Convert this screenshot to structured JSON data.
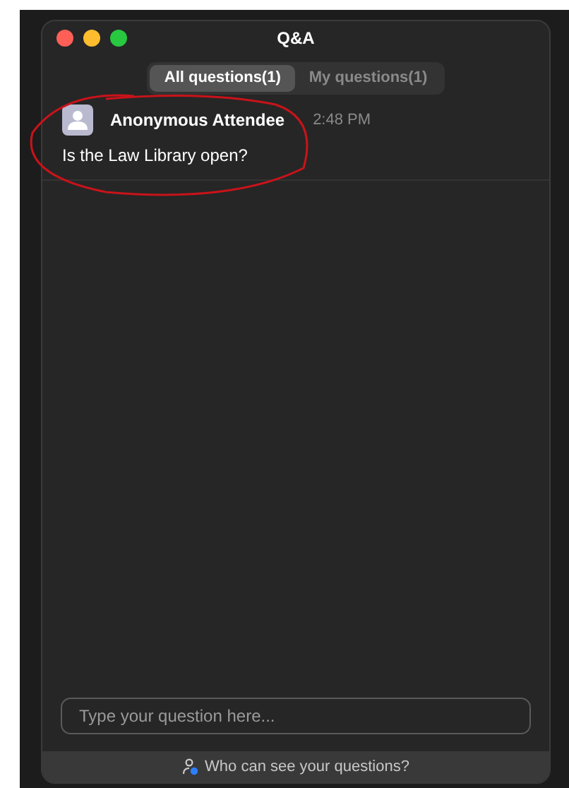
{
  "window": {
    "title": "Q&A"
  },
  "tabs": [
    {
      "label": "All questions(1)",
      "selected": true
    },
    {
      "label": "My questions(1)",
      "selected": false
    }
  ],
  "questions": [
    {
      "author": "Anonymous Attendee",
      "time": "2:48 PM",
      "text": "Is the Law Library open?"
    }
  ],
  "input": {
    "placeholder": "Type your question here..."
  },
  "footer": {
    "text": "Who can see your questions?"
  }
}
